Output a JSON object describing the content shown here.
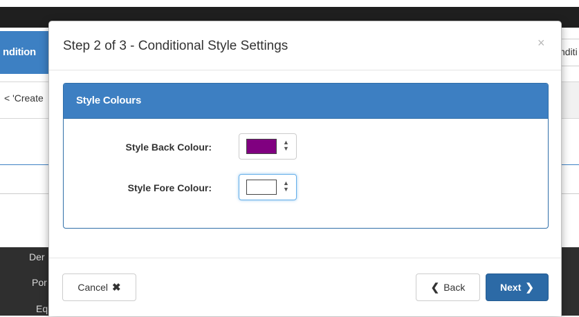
{
  "background": {
    "left_tab_label": "ndition",
    "right_tab_label": "nditi",
    "left_snippet": "< 'Create",
    "dark_items": [
      "Der",
      "Por",
      "Eq"
    ]
  },
  "modal": {
    "title": "Step 2 of 3 - Conditional Style Settings",
    "close_icon": "×",
    "panel": {
      "heading": "Style Colours",
      "fields": [
        {
          "label": "Style Back Colour:",
          "value_color": "#800080",
          "icon": "select-arrows"
        },
        {
          "label": "Style Fore Colour:",
          "value_color": "#ffffff",
          "icon": "select-arrows"
        }
      ]
    },
    "footer": {
      "cancel_label": "Cancel",
      "cancel_icon": "✖",
      "back_label": "Back",
      "back_icon": "❮",
      "next_label": "Next",
      "next_icon": "❯"
    }
  },
  "colors": {
    "primary": "#2c6aa6",
    "panel_heading": "#3d7fc2",
    "back_swatch": "#800080",
    "fore_swatch": "#ffffff"
  }
}
